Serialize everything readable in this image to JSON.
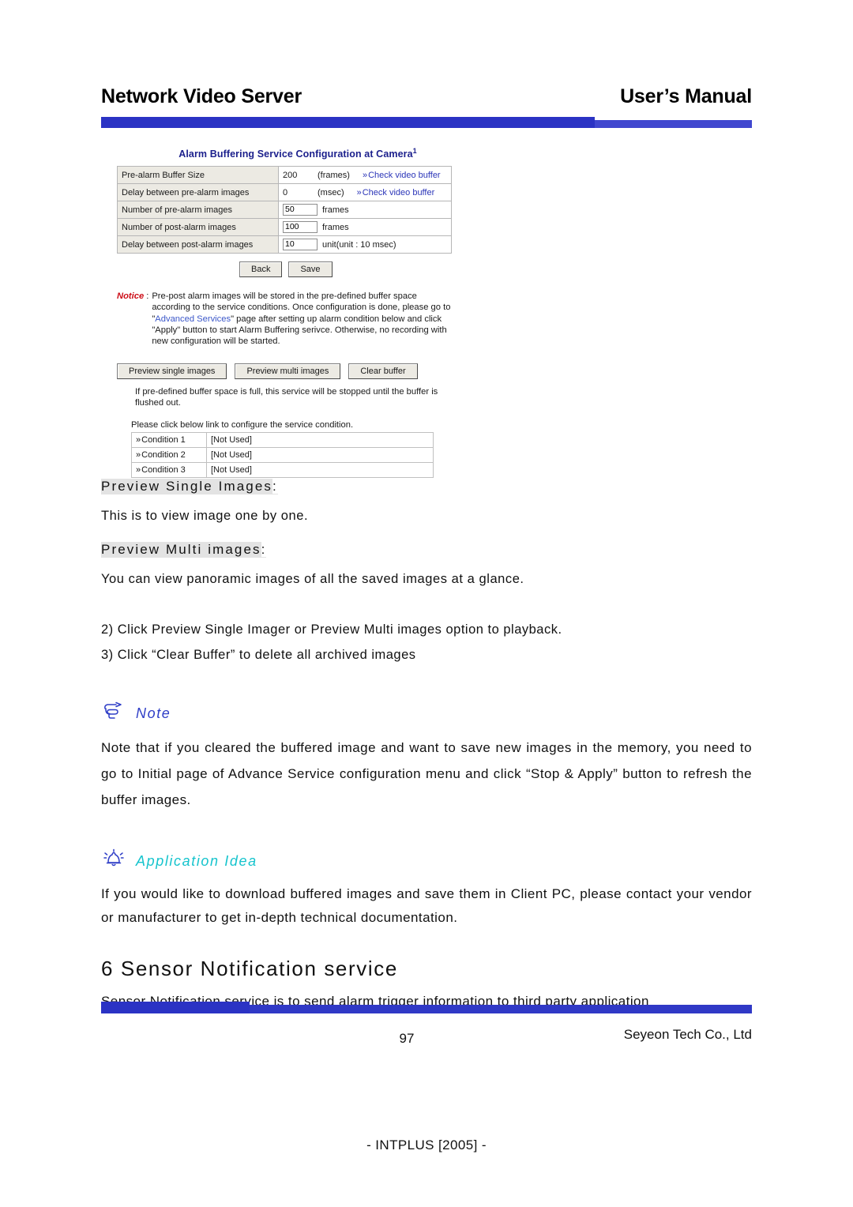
{
  "header": {
    "left_title": "Network Video Server",
    "right_title": "User’s Manual",
    "bar_color": "#2b33c4"
  },
  "app_screenshot": {
    "title": "Alarm Buffering Service Configuration at Camera",
    "title_superscript": "1",
    "config_rows": [
      {
        "label": "Pre-alarm Buffer Size",
        "value": "200",
        "boxed": false,
        "unit": "(frames)",
        "link": "Check video buffer"
      },
      {
        "label": "Delay between pre-alarm images",
        "value": "0",
        "boxed": false,
        "unit": "(msec)",
        "link": "Check video buffer"
      },
      {
        "label": "Number of pre-alarm images",
        "value": "50",
        "boxed": true,
        "unit": "frames",
        "link": ""
      },
      {
        "label": "Number of post-alarm images",
        "value": "100",
        "boxed": true,
        "unit": "frames",
        "link": ""
      },
      {
        "label": "Delay between post-alarm images",
        "value": "10",
        "boxed": true,
        "unit": "unit(unit : 10 msec)",
        "link": ""
      }
    ],
    "form_buttons": [
      {
        "label": "Back"
      },
      {
        "label": "Save"
      }
    ],
    "notice": {
      "tag": "Notice",
      "separator": ":",
      "text_before_link": "Pre-post alarm images will be stored in the pre-defined buffer space according to the service conditions. Once configuration is done, please go to \"",
      "link_text": "Advanced Services",
      "text_after_link": "\" page after setting up alarm condition below and click \"Apply\" button to start Alarm Buffering serivce. Otherwise, no recording with new configuration will be started."
    },
    "preview_buttons": [
      {
        "label": "Preview single images"
      },
      {
        "label": "Preview multi images"
      },
      {
        "label": "Clear buffer"
      }
    ],
    "buffer_hint": "If pre-defined buffer space is full, this service will be stopped until the buffer is flushed out.",
    "condition_intro": "Please click below link to configure the service condition.",
    "conditions": [
      {
        "link": "Condition 1",
        "status": "[Not Used]"
      },
      {
        "link": "Condition 2",
        "status": "[Not Used]"
      },
      {
        "link": "Condition 3",
        "status": "[Not Used]"
      }
    ],
    "link_color": "#2b35b8",
    "notice_color": "#cc0c16"
  },
  "body": {
    "preview_single_heading": "Preview Single Images",
    "preview_single_colon": ":",
    "preview_single_text": "This is to view image one by one.",
    "preview_multi_heading": "Preview Multi images",
    "preview_multi_colon": ":",
    "preview_multi_text": "You can view panoramic images of all the saved images at a glance.",
    "step_2": "2)  Click Preview Single Imager or Preview Multi images option to playback.",
    "step_3": "3)  Click “Clear Buffer” to delete all archived images",
    "note_label": "Note",
    "note_icon": "pointing-hand-icon",
    "note_text": "Note that if you cleared the buffered image and want to save new images in the memory, you need to go to Initial page of Advance Service configuration menu and click “Stop & Apply” button to refresh the buffer images.",
    "idea_label": "Application Idea",
    "idea_icon": "ringing-bell-icon",
    "idea_text": "If you would like to download buffered images and save them in Client PC, please contact your vendor or manufacturer to get in-depth technical documentation.",
    "section_heading": "6 Sensor Notification service",
    "section_text": "Sensor Notification service is to send alarm trigger information to third party application",
    "note_color": "#2f3ec7",
    "idea_color": "#16c4cd"
  },
  "footer": {
    "page_number": "97",
    "company": "Seyeon Tech Co., Ltd",
    "watermark": "- INTPLUS [2005] -"
  }
}
